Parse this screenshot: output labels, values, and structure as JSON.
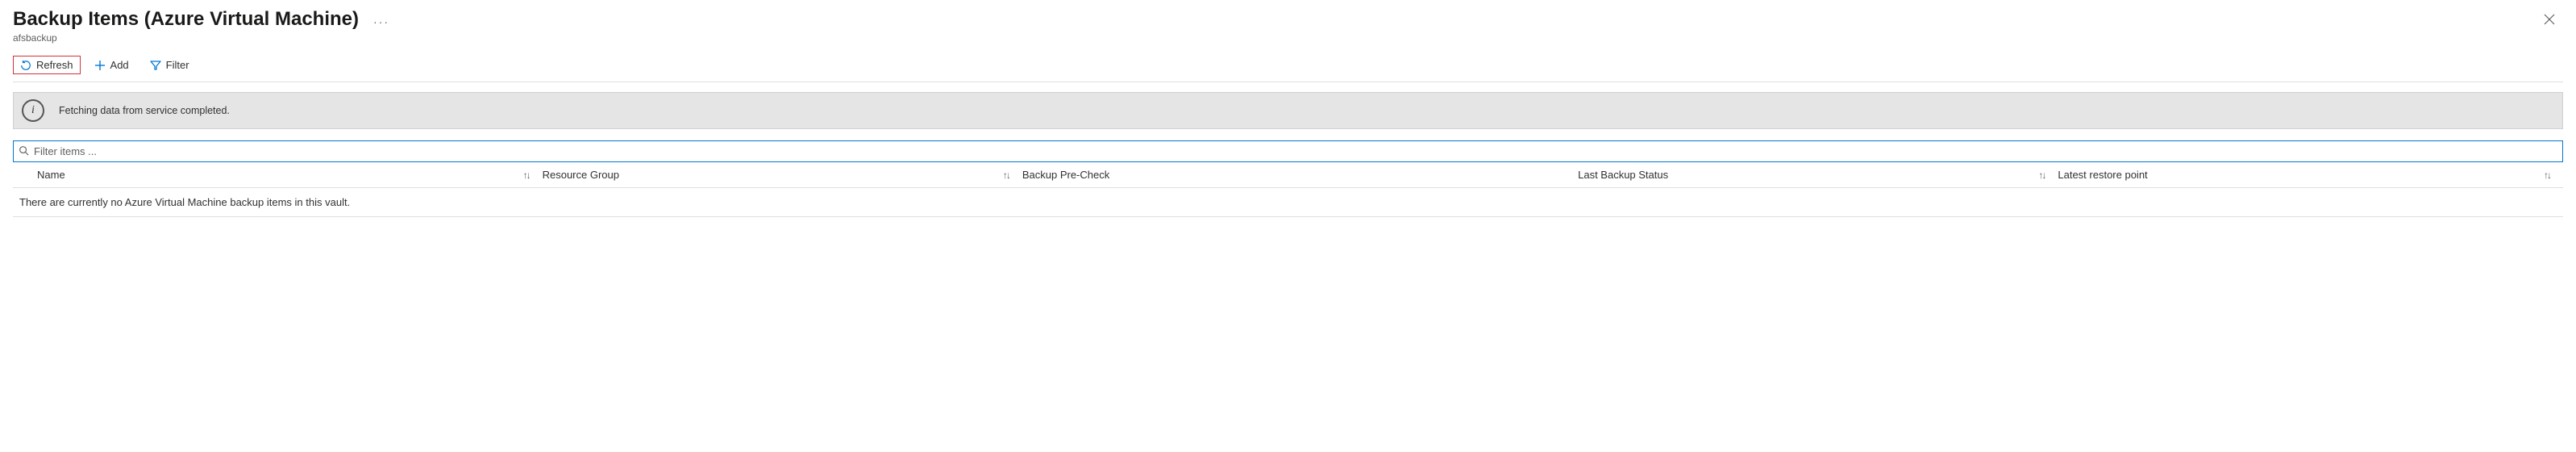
{
  "header": {
    "title": "Backup Items (Azure Virtual Machine)",
    "more_label": "···",
    "subtitle": "afsbackup"
  },
  "toolbar": {
    "refresh_label": "Refresh",
    "add_label": "Add",
    "filter_label": "Filter"
  },
  "notice": {
    "text": "Fetching data from service completed."
  },
  "filter": {
    "placeholder": "Filter items ..."
  },
  "columns": {
    "name": "Name",
    "resource_group": "Resource Group",
    "backup_precheck": "Backup Pre-Check",
    "last_backup_status": "Last Backup Status",
    "latest_restore_point": "Latest restore point"
  },
  "empty_message": "There are currently no Azure Virtual Machine backup items in this vault."
}
